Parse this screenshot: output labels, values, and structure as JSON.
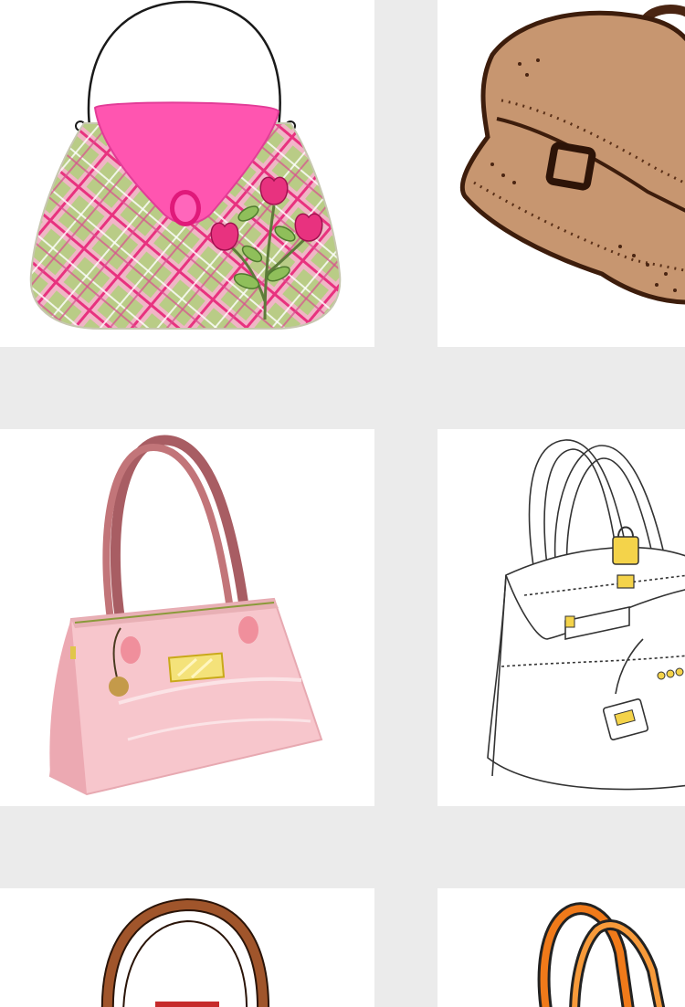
{
  "gallery": {
    "background_color": "#ebebeb",
    "tile_color": "#ffffff",
    "tiles": [
      {
        "icon": "plaid-handbag-icon",
        "colors": [
          "#ff55b0",
          "#b9cc86",
          "#f6b4cc"
        ]
      },
      {
        "icon": "brown-satchel-icon",
        "colors": [
          "#c79670",
          "#4a2512"
        ]
      },
      {
        "icon": "pink-tote-icon",
        "colors": [
          "#f7c6cc",
          "#c27579",
          "#f4e27a"
        ]
      },
      {
        "icon": "white-birkin-sketch-icon",
        "colors": [
          "#ffffff",
          "#333333",
          "#f4d34a"
        ]
      },
      {
        "icon": "brown-handle-bag-icon",
        "colors": [
          "#a0552b",
          "#c62b2b"
        ]
      },
      {
        "icon": "orange-strap-bag-icon",
        "colors": [
          "#f07a1a",
          "#222222"
        ]
      }
    ]
  }
}
